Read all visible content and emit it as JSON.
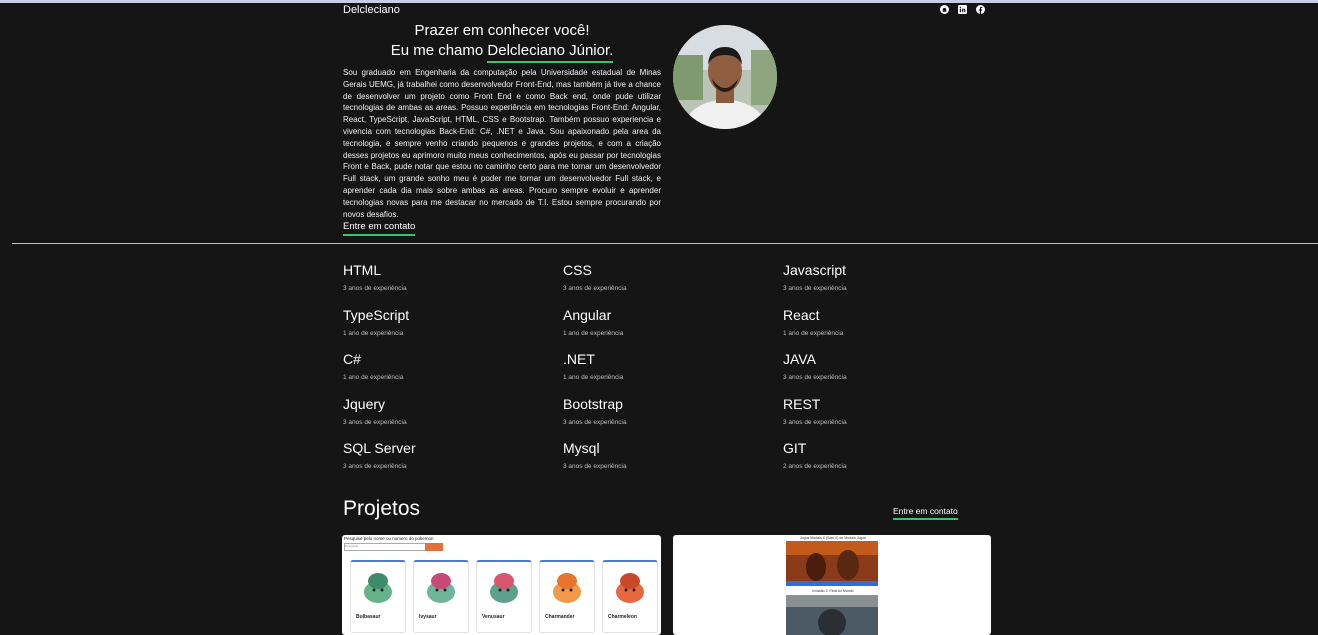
{
  "header": {
    "brand": "Delcleciano",
    "icons": [
      "github-icon",
      "linkedin-icon",
      "facebook-icon"
    ]
  },
  "hero": {
    "greeting": "Prazer em conhecer você!",
    "intro_prefix": "Eu me chamo",
    "name": "Delcleciano Júnior.",
    "bio": "Sou graduado em Engenharia da computação pela Universidade estadual de Minas Gerais UEMG, já trabalhei como desenvolvedor Front-End, mas também já tive a chance de desenvolver um projeto como Front End e como Back end, onde pude utilizar tecnologias de ambas as areas. Possuo experiência em tecnologias Front-End: Angular, React, TypeScript, JavaScript, HTML, CSS e Bootstrap. Também possuo experiencia e vivencia com tecnologias Back-End: C#, .NET e Java. Sou apaixonado pela area da tecnologia, e sempre venho criando pequenos e grandes projetos, e com a criação desses projetos eu aprimoro muito meus conhecimentos, após eu passar por tecnologias Front e Back, pude notar que estou no caminho certo para me tornar um desenvolvedor Full stack, um grande sonho meu é poder me tornar um desenvolvedor Full stack, e aprender cada dia mais sobre ambas as areas. Procuro sempre evoluir e aprender tecnologias novas para me destacar no mercado de T.I. Estou sempre procurando por novos desafios.",
    "contact_label": "Entre em contato"
  },
  "skills": [
    {
      "name": "HTML",
      "exp": "3 anos de experiência"
    },
    {
      "name": "CSS",
      "exp": "3 anos de experiência"
    },
    {
      "name": "Javascript",
      "exp": "3 anos de experiência"
    },
    {
      "name": "TypeScript",
      "exp": "1 ano de experiência"
    },
    {
      "name": "Angular",
      "exp": "1 ano de experiência"
    },
    {
      "name": "React",
      "exp": "1 ano de experiência"
    },
    {
      "name": "C#",
      "exp": "1 ano de experiência"
    },
    {
      "name": ".NET",
      "exp": "1 ano de experiência"
    },
    {
      "name": "JAVA",
      "exp": "3 anos de experiência"
    },
    {
      "name": "Jquery",
      "exp": "3 anos de experiência"
    },
    {
      "name": "Bootstrap",
      "exp": "3 anos de experiência"
    },
    {
      "name": "REST",
      "exp": "3 anos de experiência"
    },
    {
      "name": "SQL Server",
      "exp": "3 anos de experiência"
    },
    {
      "name": "Mysql",
      "exp": "3 anos de experiência"
    },
    {
      "name": "GIT",
      "exp": "2 anos de experiência"
    }
  ],
  "projects": {
    "title": "Projetos",
    "contact_label": "Entre em contato",
    "card1": {
      "search_label": "Pesquise pelo nome ou numero do pokemon",
      "search_placeholder": "Pesquisar",
      "pokemon": [
        "Bulbasaur",
        "Ivysaur",
        "Venusaur",
        "Charmander",
        "Charmeleon"
      ]
    },
    "card2": {
      "film_titles": [
        "Jogos Mortais X (Saw X) de Mortais Jogos",
        "Invasão 2: Final do Mundo"
      ]
    }
  },
  "colors": {
    "background": "#151515",
    "accent_underline": "#35c66b",
    "divider": "#bfbfbf"
  }
}
